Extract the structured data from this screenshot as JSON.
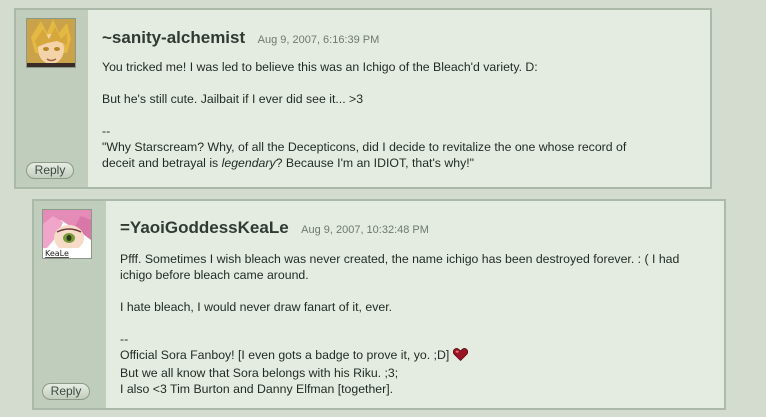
{
  "comments": [
    {
      "username": "~sanity-alchemist",
      "timestamp": "Aug 9, 2007, 6:16:39 PM",
      "paragraphs": [
        "You tricked me! I was led to believe this was an Ichigo of the Bleach'd variety. D:",
        "But he's still cute. Jailbait if I ever did see it... >3"
      ],
      "sig_separator": "--",
      "sig_line1_a": "\"Why Starscream? Why, of all the Decepticons, did I decide to revitalize the one whose record of",
      "sig_line2_a": "deceit and betrayal is ",
      "sig_line2_em": "legendary",
      "sig_line2_b": "? Because I'm an IDIOT, that's why!\"",
      "reply_label": "Reply",
      "avatar_icon": "anime-avatar-icon"
    },
    {
      "username": "=YaoiGoddessKeaLe",
      "timestamp": "Aug 9, 2007, 10:32:48 PM",
      "paragraphs": [
        "Pfff. Sometimes I wish bleach was never created, the name ichigo has been destroyed forever. : ( I had ichigo before bleach came around.",
        "I hate bleach, I would never draw fanart of it, ever."
      ],
      "sig_separator": "--",
      "sig_lines": [
        "Official Sora Fanboy! [I even gots a badge to prove it, yo. ;D]",
        "But we all know that Sora belongs with his Riku. ;3;",
        "I also <3 Tim Burton and Danny Elfman [together]."
      ],
      "reply_label": "Reply",
      "avatar_caption": "KeaLe",
      "avatar_icon": "anime-avatar-icon",
      "heart_icon": "heart-icon"
    }
  ]
}
